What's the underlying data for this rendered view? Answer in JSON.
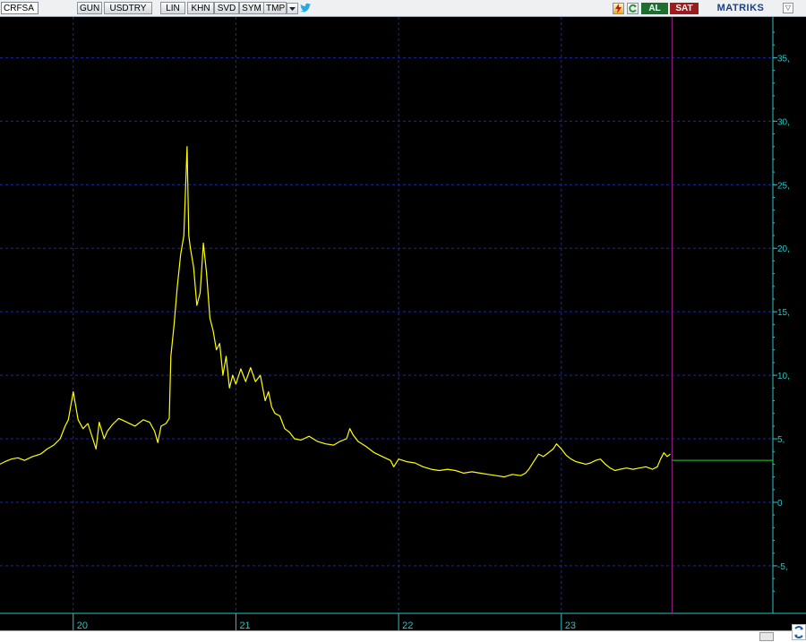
{
  "toolbar": {
    "symbol": "CRFSA",
    "buttons": [
      "GUN",
      "USDTRY",
      "LIN",
      "KHN",
      "SVD",
      "SYM",
      "TMP"
    ],
    "buy_label": "AL",
    "sell_label": "SAT",
    "brand": "MATRIKS",
    "icons": [
      "lightning-icon",
      "refresh-icon",
      "dropdown-arrow-icon",
      "twitter-bird-icon",
      "window-menu-icon"
    ]
  },
  "chart_data": {
    "type": "line",
    "series_color": "#ffff00",
    "y_ticks": [
      "35,",
      "30,",
      "25,",
      "20,",
      "15,",
      "10,",
      "5,",
      "0",
      "-5,"
    ],
    "y_tick_values": [
      35,
      30,
      25,
      20,
      15,
      10,
      5,
      0,
      -5
    ],
    "ylim": [
      -8.6,
      38.2
    ],
    "x_ticks": [
      "20",
      "21",
      "22",
      "23"
    ],
    "xlim": [
      19.55,
      24.3
    ],
    "grid": true,
    "last_value": 3.3,
    "cursor_x": 23.68,
    "points": [
      [
        19.55,
        3.0
      ],
      [
        19.58,
        3.2
      ],
      [
        19.62,
        3.4
      ],
      [
        19.66,
        3.5
      ],
      [
        19.7,
        3.3
      ],
      [
        19.75,
        3.6
      ],
      [
        19.8,
        3.8
      ],
      [
        19.84,
        4.2
      ],
      [
        19.88,
        4.5
      ],
      [
        19.92,
        5.0
      ],
      [
        19.95,
        6.0
      ],
      [
        19.97,
        6.5
      ],
      [
        20.0,
        8.7
      ],
      [
        20.03,
        6.5
      ],
      [
        20.06,
        5.8
      ],
      [
        20.09,
        6.2
      ],
      [
        20.12,
        5.0
      ],
      [
        20.14,
        4.2
      ],
      [
        20.16,
        6.3
      ],
      [
        20.19,
        5.0
      ],
      [
        20.21,
        5.6
      ],
      [
        20.24,
        6.1
      ],
      [
        20.28,
        6.6
      ],
      [
        20.33,
        6.3
      ],
      [
        20.38,
        6.0
      ],
      [
        20.43,
        6.5
      ],
      [
        20.47,
        6.3
      ],
      [
        20.5,
        5.6
      ],
      [
        20.52,
        4.7
      ],
      [
        20.54,
        6.0
      ],
      [
        20.57,
        6.2
      ],
      [
        20.59,
        6.6
      ],
      [
        20.6,
        11.5
      ],
      [
        20.62,
        14.0
      ],
      [
        20.64,
        17.0
      ],
      [
        20.66,
        19.5
      ],
      [
        20.68,
        21.0
      ],
      [
        20.7,
        28.0
      ],
      [
        20.71,
        21.0
      ],
      [
        20.72,
        20.0
      ],
      [
        20.74,
        18.5
      ],
      [
        20.76,
        15.5
      ],
      [
        20.78,
        16.5
      ],
      [
        20.8,
        20.4
      ],
      [
        20.82,
        18.0
      ],
      [
        20.84,
        14.5
      ],
      [
        20.86,
        13.5
      ],
      [
        20.88,
        12.0
      ],
      [
        20.9,
        12.5
      ],
      [
        20.92,
        10.0
      ],
      [
        20.94,
        11.5
      ],
      [
        20.96,
        9.0
      ],
      [
        20.98,
        10.0
      ],
      [
        21.0,
        9.3
      ],
      [
        21.03,
        10.5
      ],
      [
        21.06,
        9.5
      ],
      [
        21.09,
        10.6
      ],
      [
        21.12,
        9.5
      ],
      [
        21.15,
        10.0
      ],
      [
        21.18,
        8.0
      ],
      [
        21.2,
        8.7
      ],
      [
        21.22,
        7.5
      ],
      [
        21.24,
        7.0
      ],
      [
        21.27,
        6.8
      ],
      [
        21.3,
        5.8
      ],
      [
        21.33,
        5.5
      ],
      [
        21.36,
        5.0
      ],
      [
        21.4,
        4.9
      ],
      [
        21.45,
        5.2
      ],
      [
        21.5,
        4.8
      ],
      [
        21.55,
        4.6
      ],
      [
        21.6,
        4.5
      ],
      [
        21.64,
        4.8
      ],
      [
        21.68,
        5.0
      ],
      [
        21.7,
        5.8
      ],
      [
        21.72,
        5.3
      ],
      [
        21.75,
        4.8
      ],
      [
        21.8,
        4.4
      ],
      [
        21.85,
        3.9
      ],
      [
        21.9,
        3.6
      ],
      [
        21.95,
        3.3
      ],
      [
        21.97,
        2.8
      ],
      [
        22.0,
        3.4
      ],
      [
        22.05,
        3.2
      ],
      [
        22.1,
        3.1
      ],
      [
        22.15,
        2.8
      ],
      [
        22.2,
        2.6
      ],
      [
        22.25,
        2.5
      ],
      [
        22.3,
        2.6
      ],
      [
        22.35,
        2.5
      ],
      [
        22.4,
        2.3
      ],
      [
        22.45,
        2.4
      ],
      [
        22.5,
        2.3
      ],
      [
        22.55,
        2.2
      ],
      [
        22.6,
        2.1
      ],
      [
        22.65,
        2.0
      ],
      [
        22.7,
        2.2
      ],
      [
        22.75,
        2.1
      ],
      [
        22.78,
        2.3
      ],
      [
        22.8,
        2.6
      ],
      [
        22.83,
        3.2
      ],
      [
        22.86,
        3.8
      ],
      [
        22.89,
        3.6
      ],
      [
        22.92,
        3.9
      ],
      [
        22.95,
        4.2
      ],
      [
        22.97,
        4.6
      ],
      [
        23.0,
        4.2
      ],
      [
        23.03,
        3.7
      ],
      [
        23.06,
        3.4
      ],
      [
        23.09,
        3.2
      ],
      [
        23.12,
        3.1
      ],
      [
        23.15,
        3.0
      ],
      [
        23.18,
        3.1
      ],
      [
        23.21,
        3.3
      ],
      [
        23.24,
        3.4
      ],
      [
        23.27,
        3.0
      ],
      [
        23.3,
        2.7
      ],
      [
        23.33,
        2.5
      ],
      [
        23.36,
        2.6
      ],
      [
        23.4,
        2.7
      ],
      [
        23.44,
        2.6
      ],
      [
        23.48,
        2.7
      ],
      [
        23.52,
        2.8
      ],
      [
        23.56,
        2.6
      ],
      [
        23.59,
        2.8
      ],
      [
        23.61,
        3.4
      ],
      [
        23.63,
        3.9
      ],
      [
        23.65,
        3.6
      ],
      [
        23.67,
        3.8
      ]
    ]
  }
}
